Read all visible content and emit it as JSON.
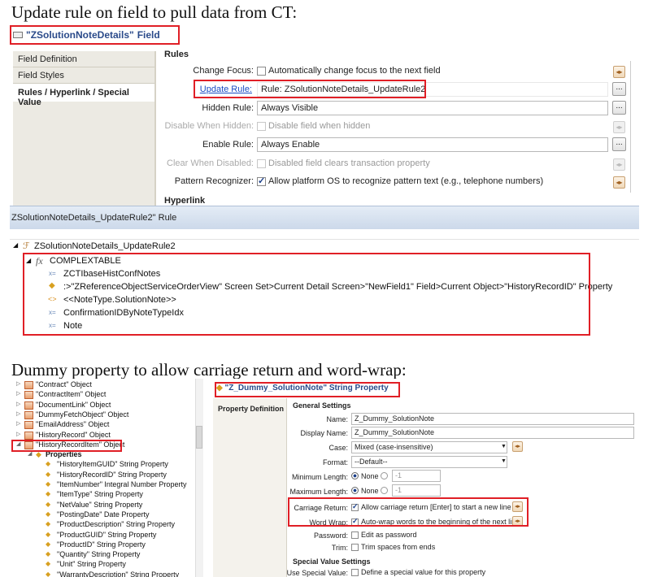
{
  "heading1": "Update rule on field to pull data from CT:",
  "heading2": "Dummy property to allow carriage return and word-wrap:",
  "field_editor": {
    "title_name": "\"ZSolutionNoteDetails\"",
    "title_suffix": "Field",
    "tabs": [
      "Field Definition",
      "Field Styles",
      "Rules / Hyperlink / Special Value"
    ],
    "section_rules": "Rules",
    "section_hyperlink": "Hyperlink",
    "rows": [
      {
        "label": "Change Focus:",
        "check": "Automatically change focus to the next field"
      },
      {
        "label": "Update Rule:",
        "value": "Rule: ZSolutionNoteDetails_UpdateRule2"
      },
      {
        "label": "Hidden Rule:",
        "value": "Always Visible"
      },
      {
        "label": "Disable When Hidden:",
        "check": "Disable field when hidden"
      },
      {
        "label": "Enable Rule:",
        "value": "Always Enable"
      },
      {
        "label": "Clear When Disabled:",
        "check": "Disabled field clears transaction property"
      },
      {
        "label": "Pattern Recognizer:",
        "check": "Allow platform OS to recognize pattern text (e.g., telephone numbers)"
      }
    ],
    "dots": "..."
  },
  "rule_editor": {
    "title": "ZSolutionNoteDetails_UpdateRule2\" Rule",
    "root": "ZSolutionNoteDetails_UpdateRule2",
    "fx": "COMPLEXTABLE",
    "fx_icon": "fx",
    "items": [
      "ZCTIbaseHistConfNotes",
      ":>\"ZReferenceObjectServiceOrderView\" Screen Set>Current Detail Screen>\"NewField1\" Field>Current Object>\"HistoryRecordID\" Property",
      "<<NoteType.SolutionNote>>",
      "ConfirmationIDByNoteTypeIdx",
      "Note"
    ],
    "item_icons": [
      "x=",
      "◆",
      "<>",
      "x=",
      "x="
    ]
  },
  "tree": {
    "objects": [
      "\"Contract\" Object",
      "\"ContractItem\" Object",
      "\"DocumentLink\" Object",
      "\"DummyFetchObject\" Object",
      "\"EmailAddress\" Object",
      "\"HistoryRecord\" Object",
      "\"HistoryRecordItem\" Object"
    ],
    "properties_label": "Properties",
    "properties": [
      "\"HistoryItemGUID\" String Property",
      "\"HistoryRecordID\" String Property",
      "\"ItemNumber\" Integral Number Property",
      "\"ItemType\" String Property",
      "\"NetValue\" String Property",
      "\"PostingDate\" Date Property",
      "\"ProductDescription\" String Property",
      "\"ProductGUID\" String Property",
      "\"ProductID\" String Property",
      "\"Quantity\" String Property",
      "\"Unit\" String Property",
      "\"WarrantyDescription\" String Property"
    ]
  },
  "property_editor": {
    "title": "\"Z_Dummy_SolutionNote\" String Property",
    "tab": "Property Definition",
    "section_general": "General Settings",
    "section_special": "Special Value Settings",
    "name_label": "Name:",
    "name_value": "Z_Dummy_SolutionNote",
    "display_label": "Display Name:",
    "display_value": "Z_Dummy_SolutionNote",
    "case_label": "Case:",
    "case_value": "Mixed (case-insensitive)",
    "format_label": "Format:",
    "format_value": "--Default--",
    "minlen_label": "Minimum Length:",
    "maxlen_label": "Maximum Length:",
    "none": "None",
    "num": "-1",
    "cr_label": "Carriage Return:",
    "cr_check": "Allow carriage return [Enter] to start a new line",
    "ww_label": "Word Wrap:",
    "ww_check": "Auto-wrap words to the beginning of the next line",
    "pw_label": "Password:",
    "pw_check": "Edit as password",
    "trim_label": "Trim:",
    "trim_check": "Trim spaces from ends",
    "special_label": "Use Special Value:",
    "special_check": "Define a special value for this property"
  }
}
